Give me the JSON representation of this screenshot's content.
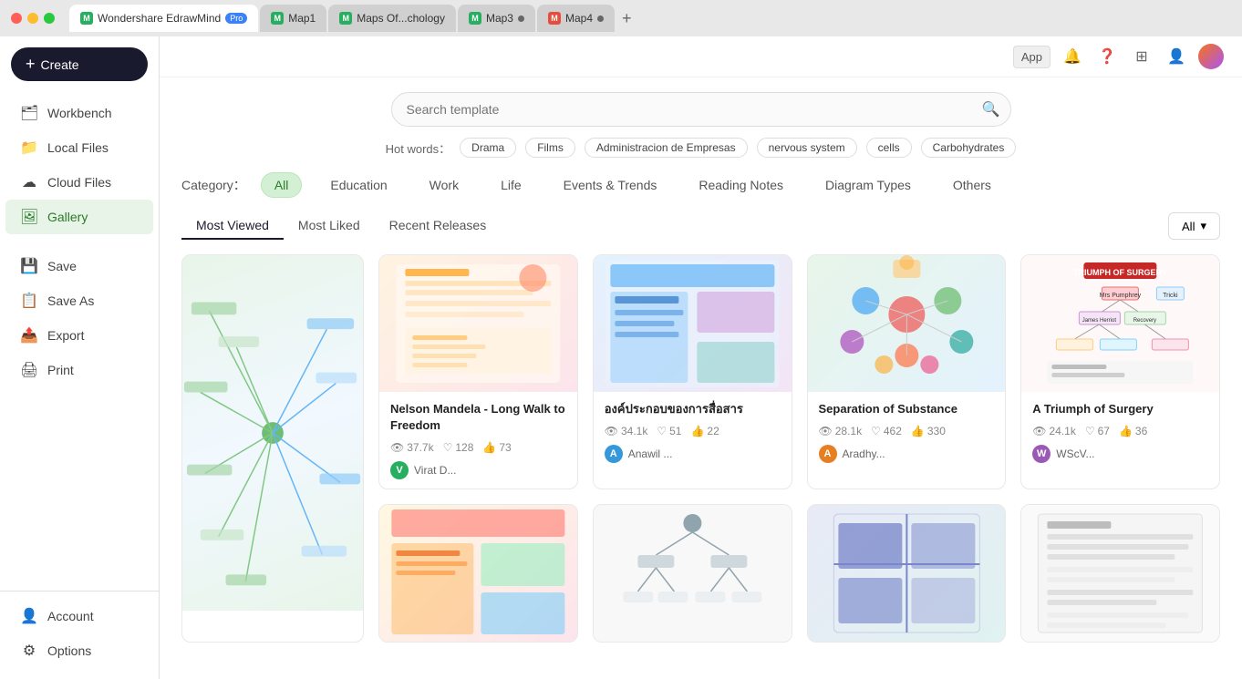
{
  "titlebar": {
    "tabs": [
      {
        "id": "edrawmind",
        "label": "Wondershare EdrawMind",
        "badge": "Pro",
        "active": false,
        "icon_color": "#2ecc71"
      },
      {
        "id": "map1",
        "label": "Map1",
        "active": false,
        "icon_color": "#27ae60"
      },
      {
        "id": "maps",
        "label": "Maps Of...chology",
        "active": false,
        "icon_color": "#27ae60"
      },
      {
        "id": "map3",
        "label": "Map3",
        "active": false,
        "icon_color": "#27ae60",
        "dot": true
      },
      {
        "id": "map4",
        "label": "Map4",
        "active": false,
        "icon_color": "#e74c3c",
        "dot": true
      }
    ],
    "new_tab_label": "+"
  },
  "topbar": {
    "app_label": "App",
    "filter_label": "All"
  },
  "sidebar": {
    "create_label": "Create",
    "items": [
      {
        "id": "workbench",
        "label": "Workbench",
        "icon": "🗂"
      },
      {
        "id": "local-files",
        "label": "Local Files",
        "icon": "📁"
      },
      {
        "id": "cloud-files",
        "label": "Cloud Files",
        "icon": "☁"
      },
      {
        "id": "gallery",
        "label": "Gallery",
        "icon": "🖼",
        "active": true
      }
    ],
    "tools": [
      {
        "id": "save",
        "label": "Save",
        "icon": "💾"
      },
      {
        "id": "save-as",
        "label": "Save As",
        "icon": "📋"
      },
      {
        "id": "export",
        "label": "Export",
        "icon": "📤"
      },
      {
        "id": "print",
        "label": "Print",
        "icon": "🖨"
      }
    ],
    "bottom": [
      {
        "id": "account",
        "label": "Account",
        "icon": "👤"
      },
      {
        "id": "options",
        "label": "Options",
        "icon": "⚙"
      }
    ]
  },
  "search": {
    "placeholder": "Search template",
    "hot_label": "Hot words：",
    "tags": [
      "Drama",
      "Films",
      "Administracion de Empresas",
      "nervous system",
      "cells",
      "Carbohydrates"
    ]
  },
  "categories": {
    "label": "Category：",
    "items": [
      "All",
      "Education",
      "Work",
      "Life",
      "Events & Trends",
      "Reading Notes",
      "Diagram Types",
      "Others"
    ],
    "active": "All"
  },
  "sort": {
    "tabs": [
      "Most Viewed",
      "Most Liked",
      "Recent Releases"
    ],
    "active": "Most Viewed",
    "filter": "All"
  },
  "cards": [
    {
      "id": "large-mindmap",
      "title": "",
      "large": true,
      "thumb_style": "large-mind",
      "stats": [],
      "author": ""
    },
    {
      "id": "nelson-mandela",
      "title": "Nelson Mandela - Long Walk to Freedom",
      "thumb_style": "nelson",
      "stats": {
        "views": "37.7k",
        "likes": "128",
        "shares": "73"
      },
      "author": {
        "name": "Virat D...",
        "color": "#27ae60",
        "initial": "V"
      }
    },
    {
      "id": "องค์ประกอบ",
      "title": "องค์ประกอบของการสื่อสาร",
      "thumb_style": "thai",
      "stats": {
        "views": "34.1k",
        "likes": "51",
        "shares": "22"
      },
      "author": {
        "name": "Anawil ...",
        "color": "#3498db",
        "initial": "A"
      }
    },
    {
      "id": "separation",
      "title": "Separation of Substance",
      "thumb_style": "separation",
      "stats": {
        "views": "28.1k",
        "likes": "462",
        "shares": "330"
      },
      "author": {
        "name": "Aradhy...",
        "color": "#e67e22",
        "initial": "A"
      }
    },
    {
      "id": "triumph-surgery",
      "title": "A Triumph of Surgery",
      "thumb_style": "surgery",
      "stats": {
        "views": "24.1k",
        "likes": "67",
        "shares": "36"
      },
      "author": {
        "name": "WScV...",
        "color": "#9b59b6",
        "initial": "W"
      }
    }
  ],
  "cards_row2": [
    {
      "id": "map-bottom-1",
      "title": "",
      "thumb_style": "bottom1"
    },
    {
      "id": "map-bottom-2",
      "title": "",
      "thumb_style": "bottom2"
    },
    {
      "id": "map-bottom-3",
      "title": "",
      "thumb_style": "bottom3"
    },
    {
      "id": "map-bottom-4",
      "title": "",
      "thumb_style": "bottom4"
    }
  ]
}
